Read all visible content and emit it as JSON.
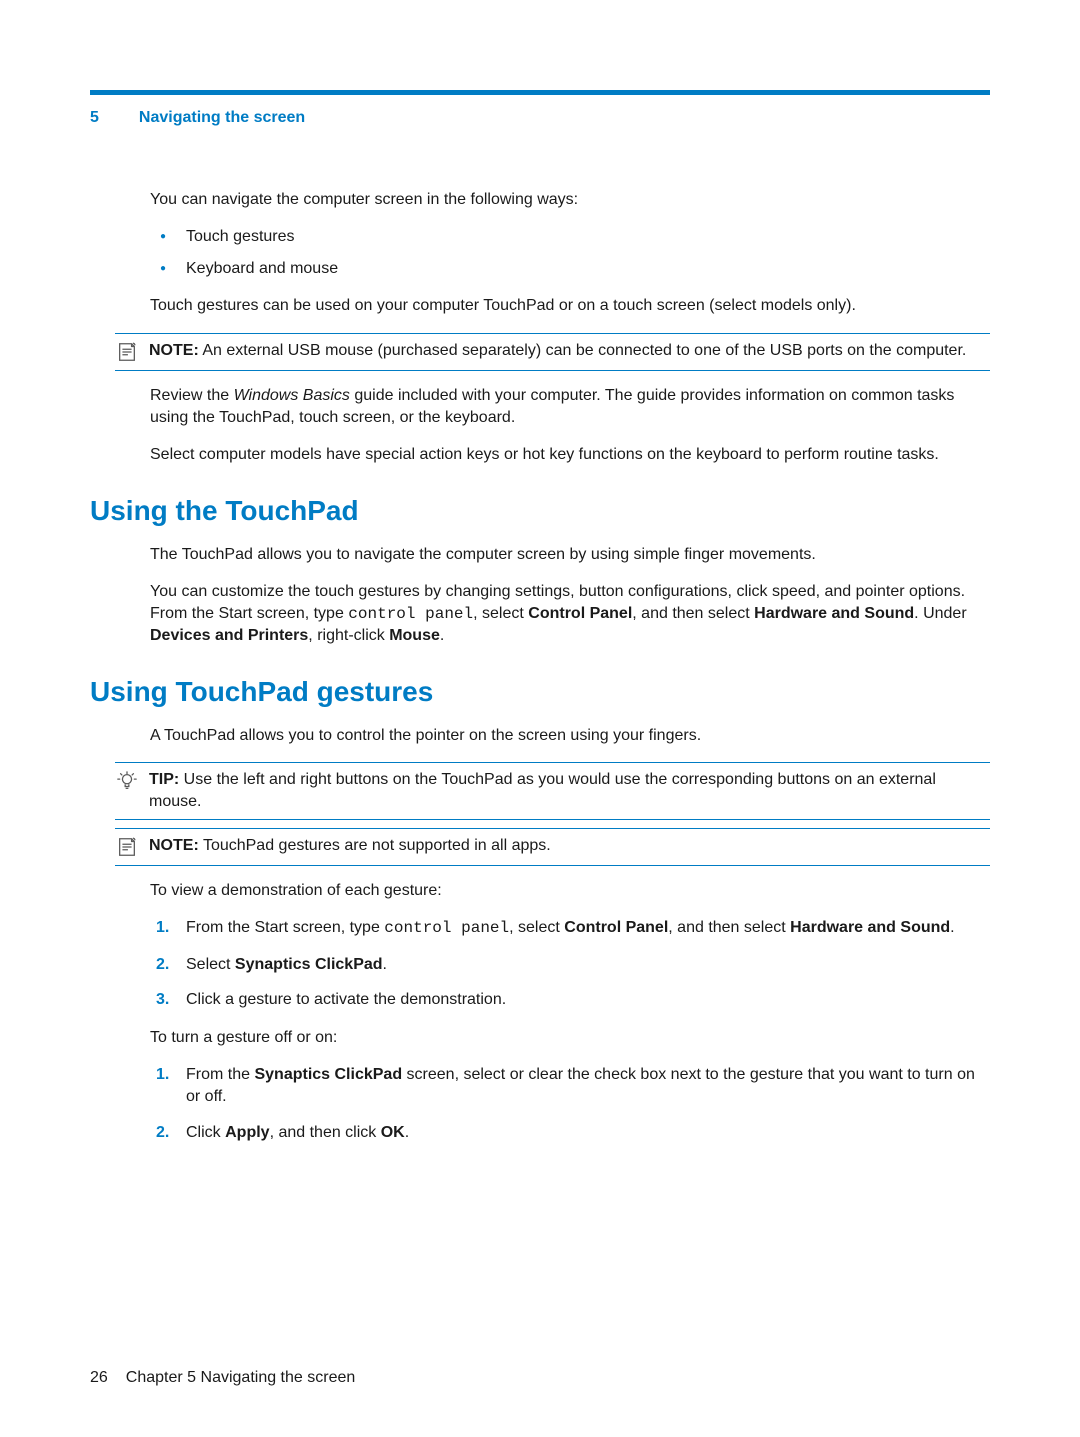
{
  "chapter": {
    "number": "5",
    "title": "Navigating the screen"
  },
  "intro": {
    "p1": "You can navigate the computer screen in the following ways:",
    "bullets": [
      "Touch gestures",
      "Keyboard and mouse"
    ],
    "p2": "Touch gestures can be used on your computer TouchPad or on a touch screen (select models only)."
  },
  "note1": {
    "label": "NOTE:",
    "text": "An external USB mouse (purchased separately) can be connected to one of the USB ports on the computer."
  },
  "review": {
    "pre": "Review the ",
    "italic": "Windows Basics",
    "post": " guide included with your computer. The guide provides information on common tasks using the TouchPad, touch screen, or the keyboard."
  },
  "review2": "Select computer models have special action keys or hot key functions on the keyboard to perform routine tasks.",
  "section_touchpad": {
    "heading": "Using the TouchPad",
    "p1": "The TouchPad allows you to navigate the computer screen by using simple finger movements.",
    "p2_pre": "You can customize the touch gestures by changing settings, button configurations, click speed, and pointer options. From the Start screen, type ",
    "p2_mono": "control panel",
    "p2_mid1": ", select ",
    "p2_b1": "Control Panel",
    "p2_mid2": ", and then select ",
    "p2_b2": "Hardware and Sound",
    "p2_mid3": ". Under ",
    "p2_b3": "Devices and Printers",
    "p2_mid4": ", right-click ",
    "p2_b4": "Mouse",
    "p2_end": "."
  },
  "section_gestures": {
    "heading": "Using TouchPad gestures",
    "p1": "A TouchPad allows you to control the pointer on the screen using your fingers."
  },
  "tip": {
    "label": "TIP:",
    "text": "Use the left and right buttons on the TouchPad as you would use the corresponding buttons on an external mouse."
  },
  "note2": {
    "label": "NOTE:",
    "text": "TouchPad gestures are not supported in all apps."
  },
  "demo": {
    "lead": "To view a demonstration of each gesture:",
    "step1_pre": "From the Start screen, type ",
    "step1_mono": "control panel",
    "step1_mid1": ", select ",
    "step1_b1": "Control Panel",
    "step1_mid2": ", and then select ",
    "step1_b2": "Hardware and Sound",
    "step1_end": ".",
    "step2_pre": "Select ",
    "step2_b": "Synaptics ClickPad",
    "step2_end": ".",
    "step3": "Click a gesture to activate the demonstration."
  },
  "toggle": {
    "lead": "To turn a gesture off or on:",
    "step1_pre": "From the ",
    "step1_b": "Synaptics ClickPad",
    "step1_post": " screen, select or clear the check box next to the gesture that you want to turn on or off.",
    "step2_pre": "Click ",
    "step2_b1": "Apply",
    "step2_mid": ", and then click ",
    "step2_b2": "OK",
    "step2_end": "."
  },
  "footer": {
    "page": "26",
    "chapter_label": "Chapter 5   Navigating the screen"
  }
}
